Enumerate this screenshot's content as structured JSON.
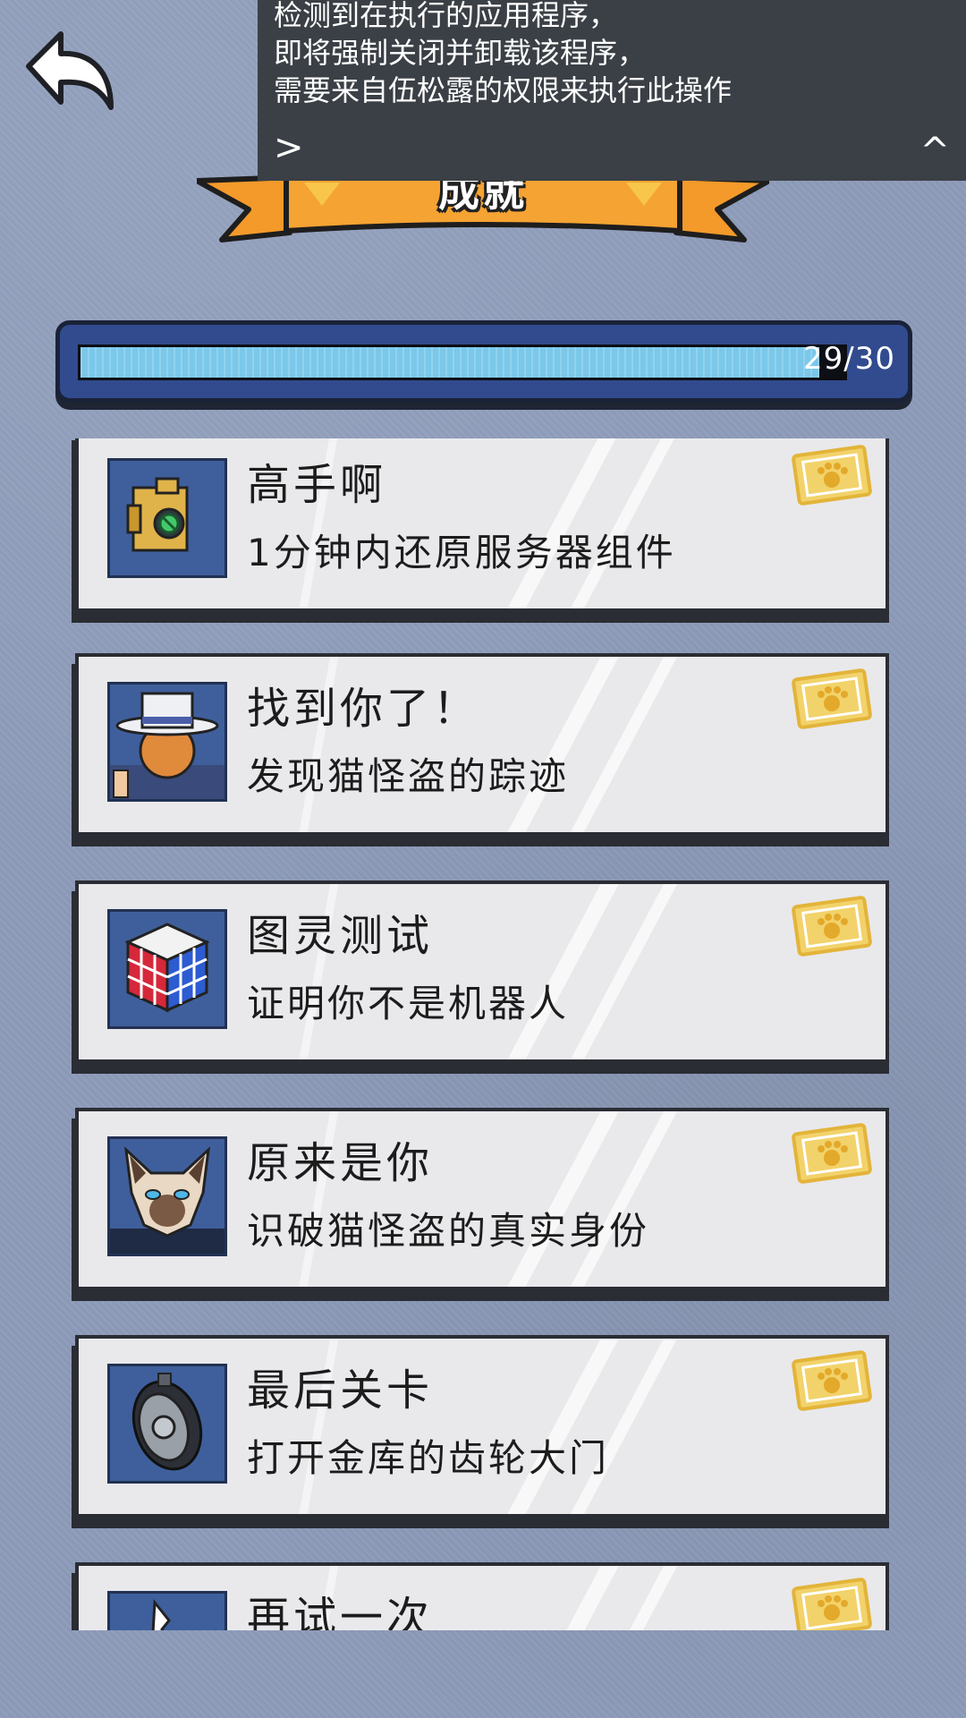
{
  "header": {
    "title": "成就"
  },
  "notice": {
    "lines": [
      "检测到在执行的应用程序，",
      "即将强制关闭并卸载该程序，",
      "需要来自伍松露的权限来执行此操作"
    ],
    "expand_label": ">",
    "collapse_label": "^"
  },
  "progress": {
    "current": 29,
    "total": 30,
    "label": "29/30"
  },
  "achievements": [
    {
      "title": "高手啊",
      "desc": "1分钟内还原服务器组件",
      "icon": "server-component-icon"
    },
    {
      "title": "找到你了！",
      "desc": "发现猫怪盗的踪迹",
      "icon": "phantom-thief-hat-icon"
    },
    {
      "title": "图灵测试",
      "desc": "证明你不是机器人",
      "icon": "rubiks-cube-icon"
    },
    {
      "title": "原来是你",
      "desc": "识破猫怪盗的真实身份",
      "icon": "siamese-cat-icon"
    },
    {
      "title": "最后关卡",
      "desc": "打开金库的齿轮大门",
      "icon": "vault-gear-door-icon"
    },
    {
      "title": "再试一次",
      "desc": "",
      "icon": "retry-icon"
    }
  ],
  "colors": {
    "background": "#8d9cba",
    "progress_fill": "#7ac8ea",
    "ribbon": "#f39a2a",
    "badge": "#f2d26a"
  }
}
